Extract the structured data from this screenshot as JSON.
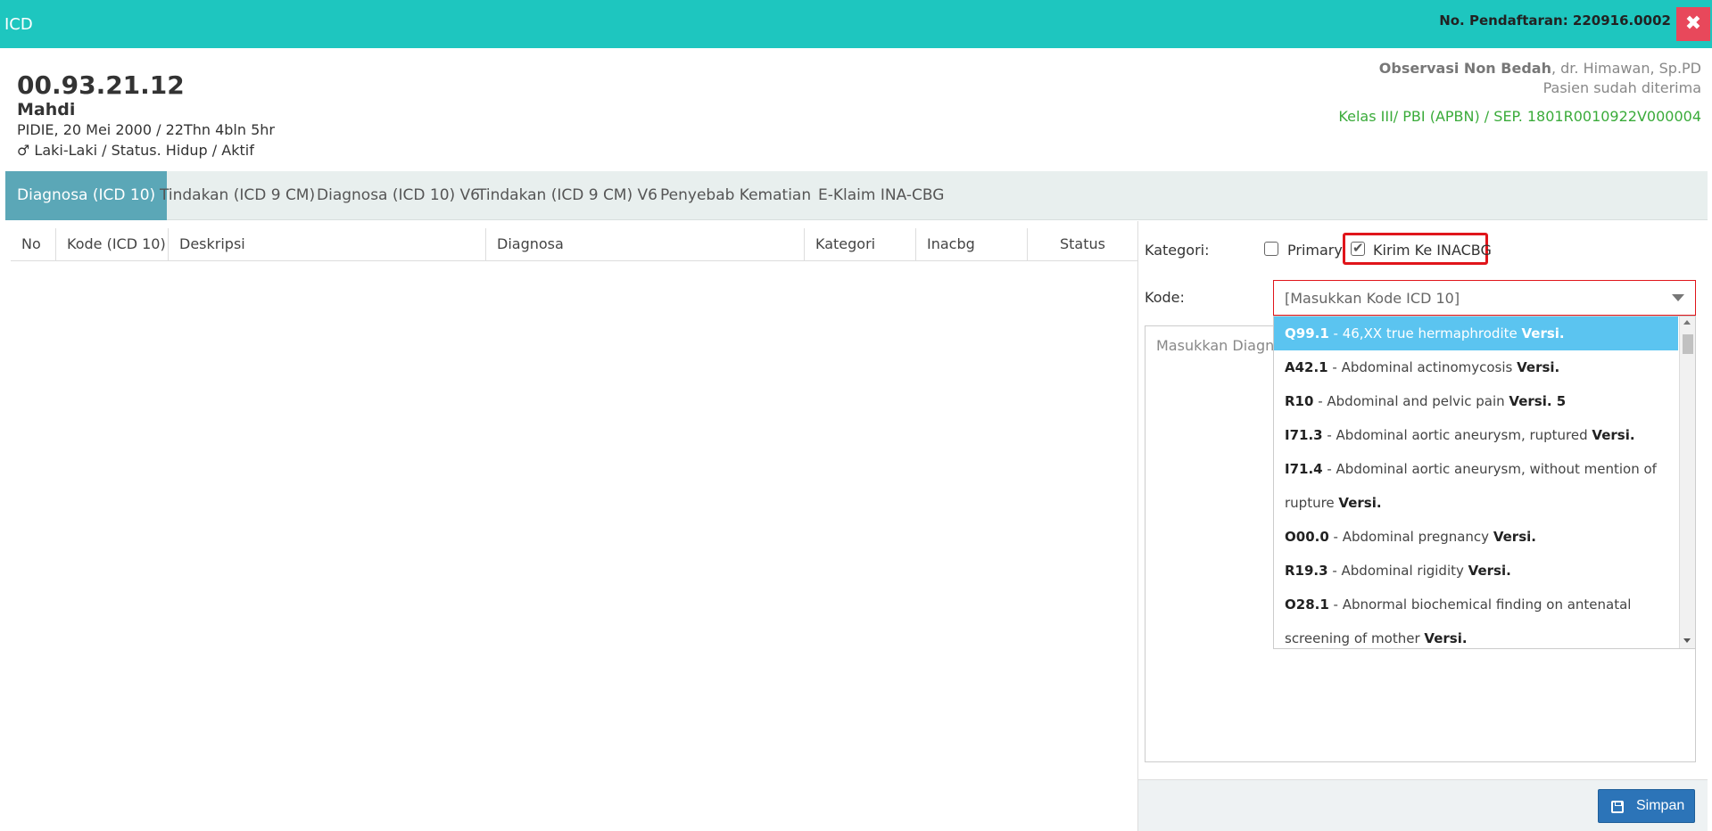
{
  "header": {
    "title": "ICD",
    "registration": "No. Pendaftaran: 220916.0002",
    "close_icon": "✖"
  },
  "patient": {
    "mrn": "00.93.21.12",
    "name": "Mahdi",
    "birth_info": "PIDIE, 20 Mei 2000 / 22Thn 4bln 5hr",
    "gender_icon": "♂",
    "gender_status": " Laki-Laki / Status. Hidup / Aktif"
  },
  "visit": {
    "unit": "Observasi Non Bedah",
    "doctor": ", dr. Himawan, Sp.PD",
    "status": "Pasien sudah diterima",
    "kelas": "Kelas III/ PBI (APBN) / SEP. 1801R0010922V000004"
  },
  "tabs": [
    {
      "label": "Diagnosa (ICD 10)",
      "active": true
    },
    {
      "label": "Tindakan (ICD 9 CM)",
      "active": false
    },
    {
      "label": "Diagnosa (ICD 10) V6",
      "active": false
    },
    {
      "label": "Tindakan (ICD 9 CM) V6",
      "active": false
    },
    {
      "label": "Penyebab Kematian",
      "active": false
    },
    {
      "label": "E-Klaim INA-CBG",
      "active": false
    }
  ],
  "table": {
    "columns": [
      "No",
      "Kode (ICD 10)",
      "Deskripsi",
      "Diagnosa",
      "Kategori",
      "Inacbg",
      "Status"
    ]
  },
  "form": {
    "kategori_label": "Kategori:",
    "primary_label": "Primary",
    "primary_checked": false,
    "kirim_label": "Kirim Ke INACBG",
    "kirim_checked": true,
    "kode_label": "Kode:",
    "kode_placeholder": "[Masukkan Kode ICD 10]",
    "diagnosa_placeholder": "Masukkan Diagno",
    "save_label": "Simpan"
  },
  "dropdown": {
    "items": [
      {
        "code": "Q99.1",
        "desc": " - 46,XX true hermaphrodite ",
        "ver": "Versi.",
        "active": true
      },
      {
        "code": "A42.1",
        "desc": " - Abdominal actinomycosis ",
        "ver": "Versi.",
        "active": false
      },
      {
        "code": "R10",
        "desc": " - Abdominal and pelvic pain ",
        "ver": "Versi. 5",
        "active": false
      },
      {
        "code": "I71.3",
        "desc": " - Abdominal aortic aneurysm, ruptured ",
        "ver": "Versi.",
        "active": false
      },
      {
        "code": "I71.4",
        "desc": " - Abdominal aortic aneurysm, without mention of rupture ",
        "ver": "Versi.",
        "active": false
      },
      {
        "code": "O00.0",
        "desc": " - Abdominal pregnancy ",
        "ver": "Versi.",
        "active": false
      },
      {
        "code": "R19.3",
        "desc": " - Abdominal rigidity ",
        "ver": "Versi.",
        "active": false
      },
      {
        "code": "O28.1",
        "desc": " - Abnormal biochemical finding on antenatal screening of mother ",
        "ver": "Versi.",
        "active": false
      }
    ]
  }
}
